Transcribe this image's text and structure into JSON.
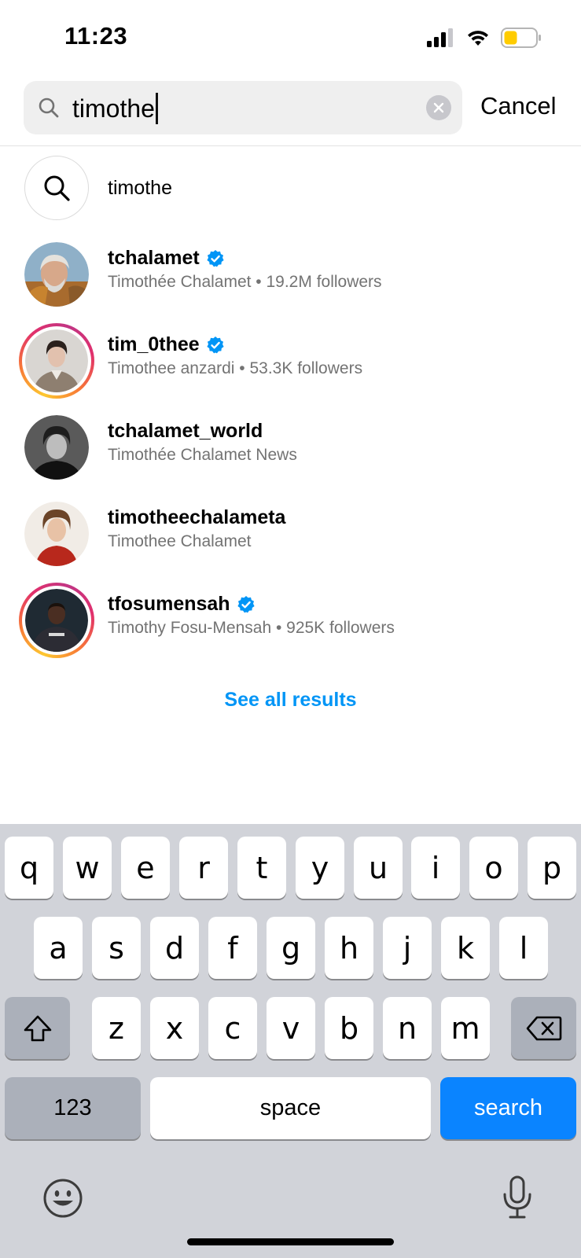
{
  "status_bar": {
    "time": "11:23",
    "icons": [
      "signal-icon",
      "wifi-icon",
      "battery-icon"
    ],
    "battery_color": "#ffcc00"
  },
  "search": {
    "query": "timothe",
    "cancel_label": "Cancel",
    "icon": "search-icon",
    "clear_icon": "clear-icon"
  },
  "results": {
    "query_suggestion": "timothe",
    "accounts": [
      {
        "username": "tchalamet",
        "verified": true,
        "subtitle": "Timothée Chalamet • 19.2M followers",
        "story_ring": false
      },
      {
        "username": "tim_0thee",
        "verified": true,
        "subtitle": "Timothee anzardi • 53.3K followers",
        "story_ring": true
      },
      {
        "username": "tchalamet_world",
        "verified": false,
        "subtitle": "Timothée Chalamet News",
        "story_ring": false
      },
      {
        "username": "timotheechalameta",
        "verified": false,
        "subtitle": "Timothee Chalamet",
        "story_ring": false
      },
      {
        "username": "tfosumensah",
        "verified": true,
        "subtitle": "Timothy Fosu-Mensah • 925K followers",
        "story_ring": true
      }
    ],
    "see_all_label": "See all results"
  },
  "keyboard": {
    "row1": [
      "q",
      "w",
      "e",
      "r",
      "t",
      "y",
      "u",
      "i",
      "o",
      "p"
    ],
    "row2": [
      "a",
      "s",
      "d",
      "f",
      "g",
      "h",
      "j",
      "k",
      "l"
    ],
    "row3": [
      "z",
      "x",
      "c",
      "v",
      "b",
      "n",
      "m"
    ],
    "numbers_label": "123",
    "space_label": "space",
    "search_label": "search",
    "icons": [
      "shift-icon",
      "backspace-icon",
      "emoji-icon",
      "microphone-icon"
    ]
  },
  "colors": {
    "accent": "#0095f6",
    "keyboard_blue": "#0a84ff",
    "verified": "#0095f6"
  }
}
